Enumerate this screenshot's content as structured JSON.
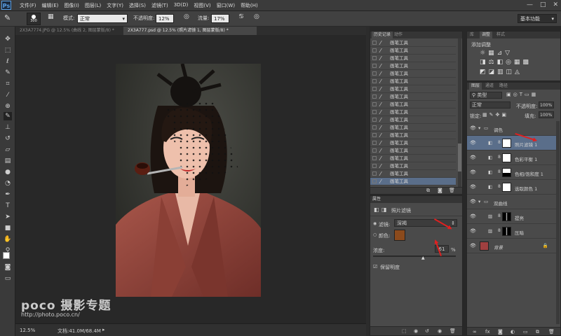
{
  "app": {
    "logo": "Ps",
    "menus": [
      "文件(F)",
      "编辑(E)",
      "图像(I)",
      "图层(L)",
      "文字(Y)",
      "选择(S)",
      "滤镜(T)",
      "3D(D)",
      "视图(V)",
      "窗口(W)",
      "帮助(H)"
    ],
    "controls": [
      "—",
      "□",
      "✕"
    ]
  },
  "options": {
    "brush_size": "300",
    "mode_label": "模式:",
    "mode_value": "正常",
    "opacity_label": "不透明度:",
    "opacity_value": "12%",
    "flow_label": "流量:",
    "flow_value": "17%",
    "workspace": "基本功能"
  },
  "tabs": [
    {
      "label": "2X3A7774.JPG @ 12.5% (曲线 2, 图层蒙版/8) *",
      "active": false
    },
    {
      "label": "2X3A777.psd @ 12.5% (照片滤镜 1, 图层蒙版/8) *",
      "active": true
    }
  ],
  "status": {
    "zoom": "12.5%",
    "doc": "文档:41.0M/68.4M"
  },
  "watermark": {
    "brand": "poco 摄影专题",
    "url": "http://photo.poco.cn/"
  },
  "history": {
    "tabs": [
      "历史记录",
      "动作"
    ],
    "items": [
      "画笔工具",
      "画笔工具",
      "画笔工具",
      "画笔工具",
      "画笔工具",
      "画笔工具",
      "画笔工具",
      "画笔工具",
      "画笔工具",
      "画笔工具",
      "画笔工具",
      "画笔工具",
      "画笔工具",
      "画笔工具",
      "画笔工具",
      "画笔工具",
      "画笔工具",
      "画笔工具",
      "画笔工具"
    ]
  },
  "properties": {
    "tab": "属性",
    "title": "照片滤镜",
    "filter_label": "滤镜:",
    "filter_value": "深褐",
    "color_label": "颜色:",
    "color": "#8b4a1c",
    "density_label": "浓度:",
    "density_value": "61",
    "density_unit": "%",
    "density": 0.61,
    "preserve_label": "保留明度"
  },
  "adjustments": {
    "tabs": [
      "库",
      "调整",
      "样式"
    ],
    "title": "添加调整"
  },
  "layers": {
    "tabs": [
      "图层",
      "通道",
      "路径"
    ],
    "kind": "类型",
    "blend": "正常",
    "opacity_label": "不透明度:",
    "opacity_value": "100%",
    "lock_label": "锁定:",
    "fill_label": "填充:",
    "fill_value": "100%",
    "rows": [
      {
        "name": "调色",
        "type": "group"
      },
      {
        "name": "照片滤镜 1",
        "type": "adj",
        "selected": true
      },
      {
        "name": "色彩平衡 1",
        "type": "adj"
      },
      {
        "name": "色相/饱和度 1",
        "type": "adj"
      },
      {
        "name": "选取颜色 1",
        "type": "adj"
      },
      {
        "name": "双曲线",
        "type": "group"
      },
      {
        "name": "提亮",
        "type": "curve"
      },
      {
        "name": "压暗",
        "type": "curve"
      },
      {
        "name": "背景",
        "type": "bg"
      }
    ]
  }
}
